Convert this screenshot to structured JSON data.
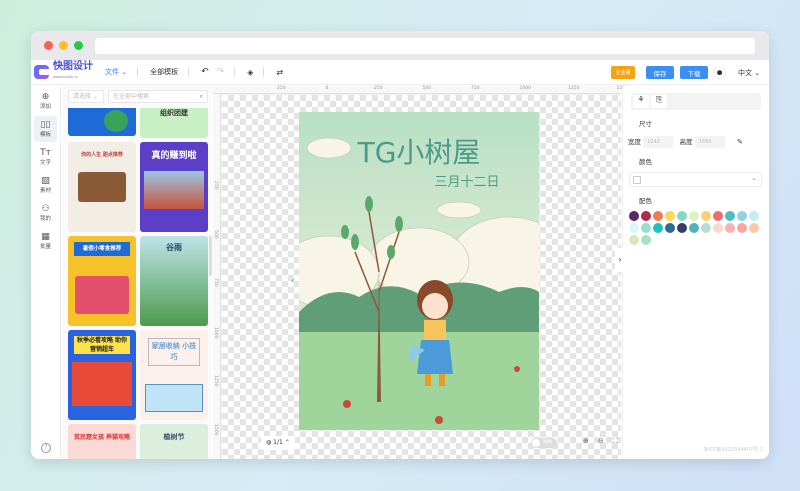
{
  "app": {
    "name": "快图设计",
    "url_tag": "www.kuaitu.cc"
  },
  "header": {
    "file": "文件",
    "templates": "全部模板",
    "enterprise": "企业版",
    "save": "保存",
    "download": "下载",
    "lang": "中文"
  },
  "sidebar": {
    "items": [
      {
        "label": "添加",
        "icon": "plus-circle"
      },
      {
        "label": "模板",
        "icon": "layout"
      },
      {
        "label": "文字",
        "icon": "text"
      },
      {
        "label": "素材",
        "icon": "image"
      },
      {
        "label": "我的",
        "icon": "user"
      },
      {
        "label": "批量",
        "icon": "table"
      }
    ]
  },
  "panel": {
    "filter_placeholder": "请选择",
    "search_placeholder": "在全部中搜索",
    "cards": [
      "组织团建",
      "真的赚到啦",
      "你的人生 甜点推荐",
      "暑假小零食推荐",
      "谷雨",
      "秋季必看攻略 助你营销超车",
      "家居收纳 小技巧",
      "贫民窟女孩 养猫攻略",
      "植树节"
    ]
  },
  "ruler": {
    "top": [
      "250",
      "0",
      "250",
      "500",
      "750",
      "1000",
      "1250",
      "1500"
    ],
    "left": [
      "250",
      "500",
      "750",
      "1000",
      "1250",
      "1500",
      "1750"
    ]
  },
  "poster": {
    "title": "TG小树屋",
    "subtitle": "三月十二日"
  },
  "bottom": {
    "page": "1/1",
    "toggle": "网格"
  },
  "right": {
    "size_label": "尺寸",
    "width_label": "宽度",
    "width_value": "1242",
    "height_label": "高度",
    "height_value": "1660",
    "color_label": "颜色",
    "palette_label": "配色",
    "palette": [
      "#5a2a63",
      "#b02a4a",
      "#ef7a4a",
      "#fbd85a",
      "#86d7c6",
      "#dcf5c0",
      "#fbd077",
      "#ee6b6e",
      "#4dbdbd",
      "#8fd3e0",
      "#c5ebf3",
      "#dbf8f8",
      "#95e0cc",
      "#1fbfc0",
      "#2f6a91",
      "#3a3a6a",
      "#4fb4b6",
      "#b9dcd3",
      "#f9dad2",
      "#fbb0b4",
      "#f8a6a0",
      "#fcc7a6",
      "#d6e9b6",
      "#a8e0c6"
    ],
    "icp": "浙ICP备2022034407号-2"
  }
}
